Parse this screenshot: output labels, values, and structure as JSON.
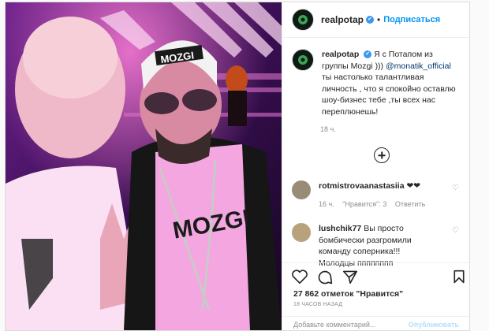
{
  "post": {
    "username": "realpotap",
    "verified_mark": "✔",
    "separator": "•",
    "follow_label": "Подписаться",
    "caption_pre": "Я с Потапом из группы Mozgi ))) ",
    "caption_mention": "@monatik_official",
    "caption_post": " ты настолько талантливая личность , что я спокойно оставлю шоу-бизнес тебе ,ты всех нас переплюнешь!",
    "caption_time": "18 ч.",
    "photo_cap_text": "MOZGI",
    "shirt_text": "MOZGI"
  },
  "comments": [
    {
      "username": "rotmistrovaanastasiia",
      "text": " ❤❤",
      "time": "16 ч.",
      "likes": "\"Нравится\": 3",
      "reply": "Ответить",
      "avatar_color": "#9a8a78"
    },
    {
      "username": "lushchik77",
      "text": " Вы просто бомбически разгромили команду соперника!!! Молодцы ",
      "text_tail": "пппппппп",
      "avatar_color": "#b8a27c"
    }
  ],
  "stats": {
    "likes": "27 862 отметок \"Нравится\"",
    "ago": "18 ЧАСОВ НАЗАД"
  },
  "add_comment": {
    "placeholder": "Добавьте комментарий...",
    "publish_label": "Опубликовать"
  },
  "icons": [
    "heart-icon",
    "comment-icon",
    "share-icon",
    "bookmark-icon",
    "plus-circle-icon",
    "verified-icon"
  ],
  "colors": {
    "accent": "#0095f6",
    "photo_bg": "#2a0c3a",
    "shirt_pink": "#f4a6e0"
  }
}
